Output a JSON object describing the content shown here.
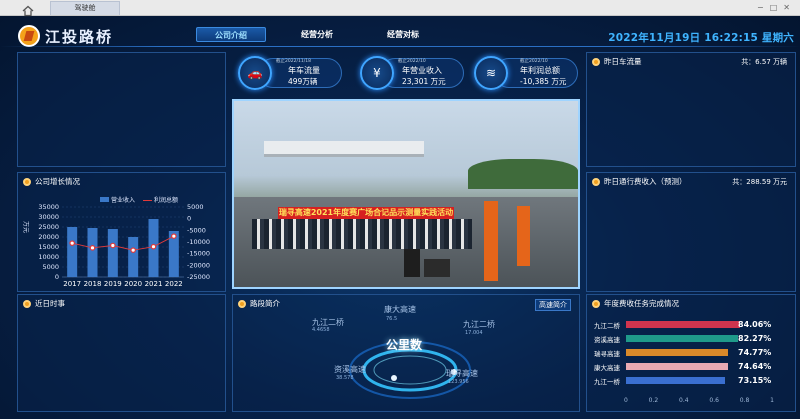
{
  "browser": {
    "tab_label": "驾驶舱"
  },
  "header": {
    "logo_text": "江投路桥",
    "nav": [
      "公司介绍",
      "经营分析",
      "经营对标"
    ],
    "active_index": 0,
    "clock": "2022年11月19日 16:22:15 星期六"
  },
  "stats": [
    {
      "sub": "截止2022/11/18",
      "label": "年车流量",
      "value": "499万辆",
      "icon": "car-icon"
    },
    {
      "sub": "截止2022/10",
      "label": "年营业收入",
      "value": "23,301 万元",
      "icon": "yen-icon"
    },
    {
      "sub": "截止2022/10",
      "label": "年利润总额",
      "value": "-10,385 万元",
      "icon": "coin-icon"
    }
  ],
  "panels": {
    "growth": {
      "title": "公司增长情况"
    },
    "news": {
      "title": "近日时事"
    },
    "road": {
      "title": "路段简介",
      "tab": "高速简介"
    },
    "traffic": {
      "title": "昨日车流量",
      "extra": "共：6.57 万辆"
    },
    "toll": {
      "title": "昨日通行费收入（预测）",
      "extra": "共：288.59 万元"
    },
    "task": {
      "title": "年度费收任务完成情况"
    }
  },
  "photo": {
    "banner_text": "瑞寻高速2021年度赛广场合记品示测量实践活动"
  },
  "chart_data": {
    "type": "bar",
    "categories": [
      "2017",
      "2018",
      "2019",
      "2020",
      "2021",
      "2022"
    ],
    "ylabel": "万元",
    "ylim": [
      0,
      35000
    ],
    "y2lim": [
      -25000,
      5000
    ],
    "yticks": [
      0,
      5000,
      10000,
      15000,
      20000,
      25000,
      30000,
      35000
    ],
    "y2ticks": [
      5000,
      0,
      -5000,
      -10000,
      -15000,
      -20000,
      -25000
    ],
    "series": [
      {
        "name": "营业收入",
        "type": "bar",
        "values": [
          25000,
          24500,
          24000,
          20000,
          29000,
          23000
        ],
        "color": "#3a78c8"
      },
      {
        "name": "利润总额",
        "type": "line",
        "values": [
          -10500,
          -12500,
          -11500,
          -13500,
          -12000,
          -7500
        ],
        "color": "#e03a3a"
      }
    ]
  },
  "road_map": {
    "center": "公里数",
    "labels": [
      {
        "name": "九江二桥",
        "num": "4.4658"
      },
      {
        "name": "康大高速",
        "num": "76.5"
      },
      {
        "name": "九江二桥",
        "num": "17.004"
      },
      {
        "name": "资溪高速",
        "num": "38.578"
      },
      {
        "name": "瑞寻高速",
        "num": "123.956"
      }
    ]
  },
  "task_chart": {
    "rows": [
      {
        "name": "九江二桥",
        "pct": "84.06%",
        "value": 84.06,
        "color": "#d0344e"
      },
      {
        "name": "资溪高速",
        "pct": "82.27%",
        "value": 82.27,
        "color": "#1f9a8a"
      },
      {
        "name": "瑞寻高速",
        "pct": "74.77%",
        "value": 74.77,
        "color": "#d9892a"
      },
      {
        "name": "康大高速",
        "pct": "74.64%",
        "value": 74.64,
        "color": "#e8a9b3"
      },
      {
        "name": "九江一桥",
        "pct": "73.15%",
        "value": 73.15,
        "color": "#3a6fd0"
      }
    ],
    "axis": [
      "0",
      "0.2",
      "0.4",
      "0.6",
      "0.8",
      "1"
    ]
  }
}
